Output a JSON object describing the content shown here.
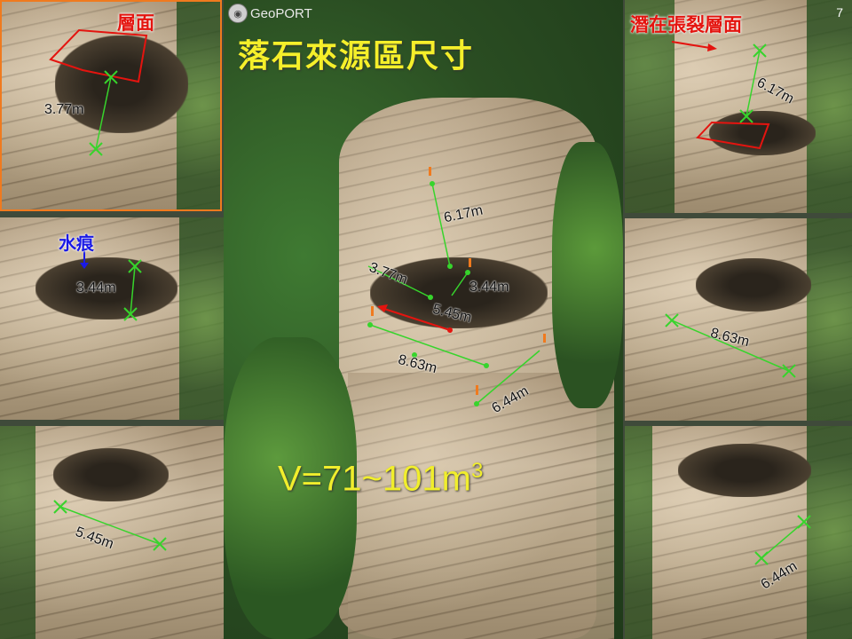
{
  "title": "落石來源區尺寸",
  "logo": {
    "icon": "globe-logo-icon",
    "text": "GeoPORT"
  },
  "page_number": "7",
  "volume": {
    "main": "V=71~101m",
    "superscript": "3"
  },
  "colors": {
    "measure_line": "#37d42c",
    "highlight_red": "#e4140f",
    "label_blue": "#1a1ae6",
    "title_yellow": "#f5ef2a",
    "panel_border": "#f07a1e"
  },
  "panels": {
    "top_left": {
      "label": "層面",
      "measurement": "3.77m"
    },
    "mid_left": {
      "label": "水痕",
      "measurement": "3.44m"
    },
    "bottom_left": {
      "measurement": "5.45m"
    },
    "top_right": {
      "label": "潛在張裂層面",
      "measurement": "6.17m"
    },
    "mid_right": {
      "measurement": "8.63m"
    },
    "bottom_right": {
      "measurement": "6.44m"
    }
  },
  "center": {
    "m617": "6.17m",
    "m377": "3.77m",
    "m344": "3.44m",
    "m545": "5.45m",
    "m863": "8.63m",
    "m644": "6.44m"
  }
}
